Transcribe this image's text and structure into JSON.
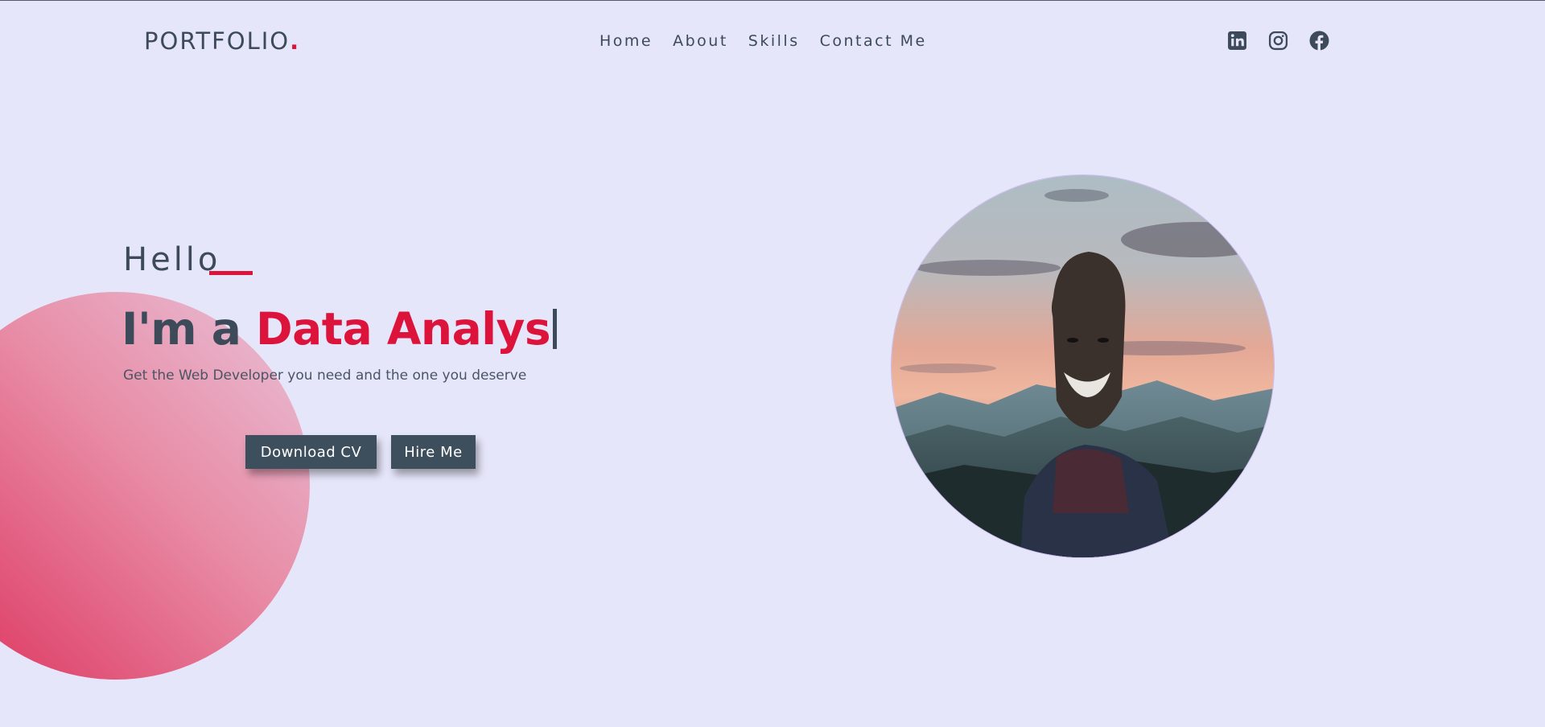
{
  "header": {
    "logo": "PORTFOLIO",
    "logo_dot": ".",
    "nav": [
      "Home",
      "About",
      "Skills",
      "Contact Me"
    ],
    "socials": [
      "linkedin-icon",
      "instagram-icon",
      "facebook-icon"
    ]
  },
  "hero": {
    "greeting": "Hello",
    "headline_prefix": "I'm a ",
    "headline_role": "Data Analys",
    "subtitle": "Get the Web Developer you need and the one you deserve",
    "buttons": {
      "download_cv": "Download CV",
      "hire_me": "Hire Me"
    }
  },
  "colors": {
    "background": "#e6e6fa",
    "accent": "#dc143c",
    "text": "#3d4a5a",
    "button": "#3d4e5c"
  }
}
